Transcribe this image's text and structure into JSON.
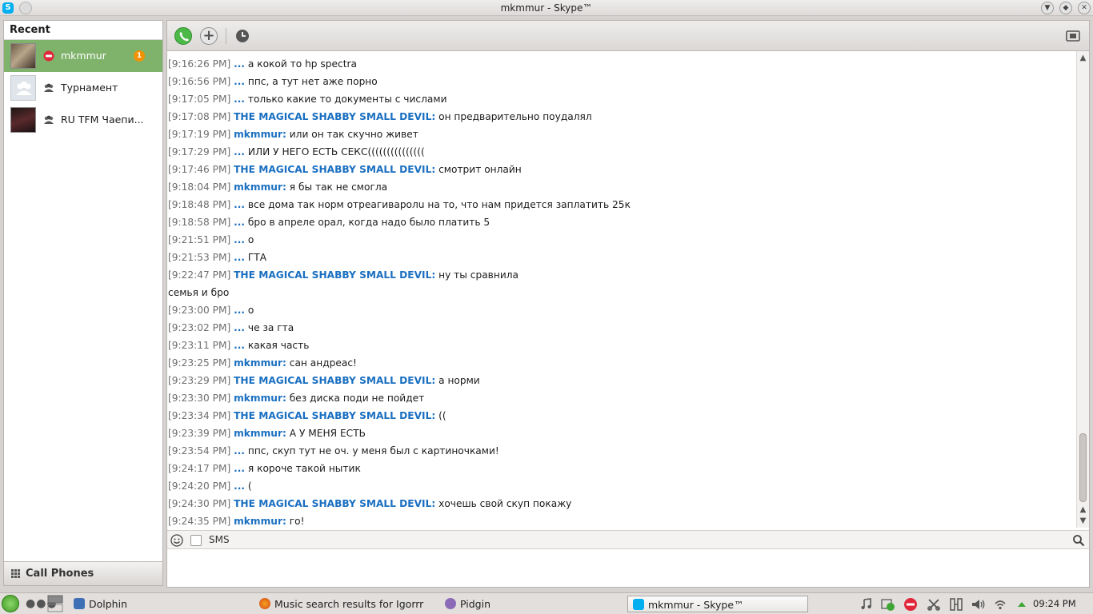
{
  "window": {
    "title": "mkmmur - Skype™",
    "app_icon": "skype-icon",
    "controls": [
      "minimize-icon",
      "maximize-icon",
      "close-icon"
    ]
  },
  "sidebar": {
    "recent_label": "Recent",
    "contacts": [
      {
        "name": "mkmmur",
        "status_icon": "do-not-disturb-icon",
        "badge": "1",
        "selected": true
      },
      {
        "name": "Турнамент",
        "status_icon": "group-icon"
      },
      {
        "name": "RU TFM Чаепи...",
        "status_icon": "group-icon"
      }
    ],
    "call_phones_label": "Call Phones"
  },
  "toolbar": {
    "icons": [
      "call-icon",
      "add-icon",
      "history-icon",
      "screen-share-icon"
    ]
  },
  "messages": [
    {
      "ts": "[9:16:26 PM]",
      "who": "...",
      "text": " а кокой то hp spectra"
    },
    {
      "ts": "[9:16:56 PM]",
      "who": "...",
      "text": " ппс, а тут нет аже порно"
    },
    {
      "ts": "[9:17:05 PM]",
      "who": "...",
      "text": " только какие то документы с числами"
    },
    {
      "ts": "[9:17:08 PM]",
      "who": "THE MAGICAL SHABBY SMALL DEVIL:",
      "text": " он предварительно поудалял"
    },
    {
      "ts": "[9:17:19 PM]",
      "who": "mkmmur:",
      "text": " или он так скучно живет"
    },
    {
      "ts": "[9:17:29 PM]",
      "who": "...",
      "text": " ИЛИ У НЕГО ЕСТЬ СЕКС((((((((((((((("
    },
    {
      "ts": "[9:17:46 PM]",
      "who": "THE MAGICAL SHABBY SMALL DEVIL:",
      "text": " смотрит онлайн"
    },
    {
      "ts": "[9:18:04 PM]",
      "who": "mkmmur:",
      "text": " я бы так не смогла"
    },
    {
      "ts": "[9:18:48 PM]",
      "who": "...",
      "text": " все дома так норм отреагиваролu на то, что нам придется заплатить 25к"
    },
    {
      "ts": "[9:18:58 PM]",
      "who": "...",
      "text": " бро в апреле орал, когда надо было платить 5"
    },
    {
      "ts": "[9:21:51 PM]",
      "who": "...",
      "text": " о"
    },
    {
      "ts": "[9:21:53 PM]",
      "who": "...",
      "text": " ГТА"
    },
    {
      "ts": "[9:22:47 PM]",
      "who": "THE MAGICAL SHABBY SMALL DEVIL:",
      "text": " ну ты сравнила"
    },
    {
      "ts": "",
      "who": "",
      "text": "семья и бро"
    },
    {
      "ts": "[9:23:00 PM]",
      "who": "...",
      "text": " о"
    },
    {
      "ts": "[9:23:02 PM]",
      "who": "...",
      "text": " че за гта"
    },
    {
      "ts": "[9:23:11 PM]",
      "who": "...",
      "text": " какая часть"
    },
    {
      "ts": "[9:23:25 PM]",
      "who": "mkmmur:",
      "text": " сан андреас!"
    },
    {
      "ts": "[9:23:29 PM]",
      "who": "THE MAGICAL SHABBY SMALL DEVIL:",
      "text": " а норми"
    },
    {
      "ts": "[9:23:30 PM]",
      "who": "mkmmur:",
      "text": "  без диска поди не пойдет"
    },
    {
      "ts": "[9:23:34 PM]",
      "who": "THE MAGICAL SHABBY SMALL DEVIL:",
      "text": " (("
    },
    {
      "ts": "[9:23:39 PM]",
      "who": "mkmmur:",
      "text": " А У МЕНЯ ЕСТЬ"
    },
    {
      "ts": "[9:23:54 PM]",
      "who": "...",
      "text": " ппс, скуп тут не оч. у меня был с картиночками!"
    },
    {
      "ts": "[9:24:17 PM]",
      "who": "...",
      "text": " я короче такой нытик"
    },
    {
      "ts": "[9:24:20 PM]",
      "who": "...",
      "text": " ("
    },
    {
      "ts": "[9:24:30 PM]",
      "who": "THE MAGICAL SHABBY SMALL DEVIL:",
      "text": " хочешь свой скуп покажу"
    },
    {
      "ts": "[9:24:35 PM]",
      "who": "mkmmur:",
      "text": " го!"
    }
  ],
  "input_bar": {
    "sms_label": "SMS",
    "icons": [
      "emoji-icon",
      "search-icon"
    ]
  },
  "taskbar": {
    "tasks": [
      {
        "label": "Dolphin",
        "icon": "dolphin-icon"
      },
      {
        "label": "Music search results for Igorrr",
        "icon": "firefox-icon"
      },
      {
        "label": "Pidgin",
        "icon": "pidgin-icon"
      },
      {
        "label": "mkmmur - Skype™",
        "icon": "skype-icon",
        "active": true
      }
    ],
    "tray_icons": [
      "music-icon",
      "updates-icon",
      "skype-dnd-icon",
      "klipper-icon",
      "network-icon",
      "volume-icon",
      "wifi-icon",
      "tray-expand-icon"
    ],
    "clock": "09:24 PM"
  },
  "colors": {
    "selected_contact": "#7fb36b",
    "sender_name": "#1a6fc1",
    "badge": "#f39200",
    "call_button": "#4cb848"
  }
}
